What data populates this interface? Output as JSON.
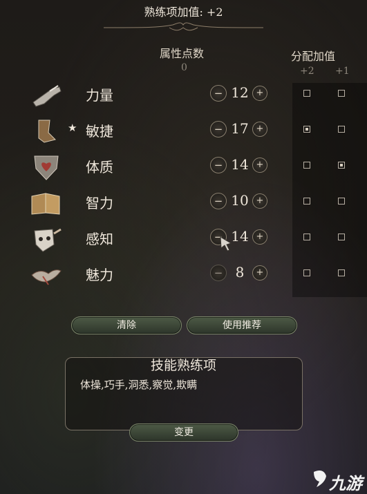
{
  "header": {
    "title": "熟练项加值: +2"
  },
  "points": {
    "label": "属性点数",
    "value": "0"
  },
  "bonus": {
    "label": "分配加值",
    "plus2": "+2",
    "plus1": "+1"
  },
  "abilities": [
    {
      "name": "力量",
      "score": "12",
      "starred": false,
      "plus2": false,
      "plus1": false,
      "icon": "gauntlet-icon"
    },
    {
      "name": "敏捷",
      "score": "17",
      "starred": true,
      "plus2": true,
      "plus1": false,
      "icon": "boot-icon",
      "star": "★"
    },
    {
      "name": "体质",
      "score": "14",
      "starred": false,
      "plus2": false,
      "plus1": true,
      "icon": "heart-shield-icon"
    },
    {
      "name": "智力",
      "score": "10",
      "starred": false,
      "plus2": false,
      "plus1": false,
      "icon": "book-icon"
    },
    {
      "name": "感知",
      "score": "14",
      "starred": false,
      "plus2": false,
      "plus1": false,
      "icon": "mask-icon"
    },
    {
      "name": "魅力",
      "score": "8",
      "starred": false,
      "plus2": false,
      "plus1": false,
      "icon": "bird-icon"
    }
  ],
  "buttons": {
    "clear": "清除",
    "recommend": "使用推荐",
    "change": "变更",
    "minus": "−",
    "plus": "+"
  },
  "skills": {
    "title": "技能熟练项",
    "list": "体操,巧手,洞悉,察觉,欺瞒"
  },
  "watermark": {
    "text": "九游"
  }
}
